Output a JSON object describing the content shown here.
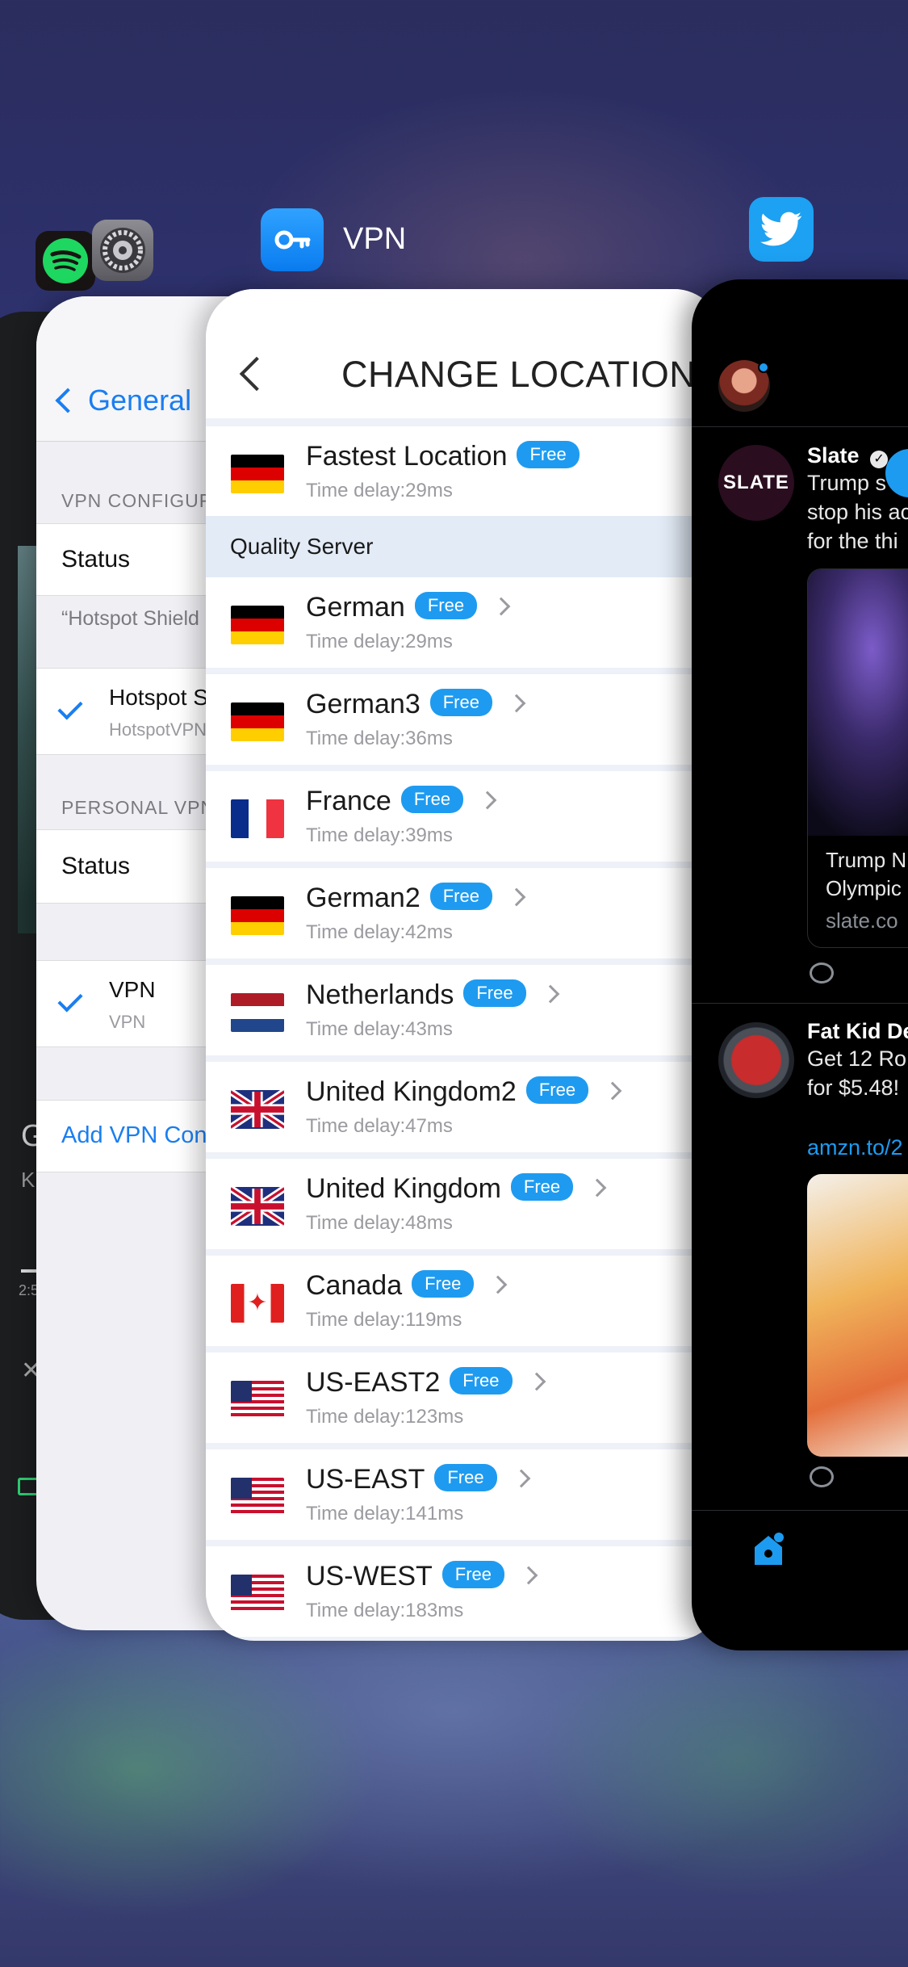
{
  "switcher": {
    "vpn_app_title": "VPN"
  },
  "music_card": {
    "letter_g": "G",
    "letter_k": "K",
    "time": "2:5"
  },
  "settings": {
    "back_label": "General",
    "vpn_config_header": "VPN CONFIGUR",
    "status_label_1": "Status",
    "note": "“Hotspot Shield",
    "vpn_profile_title": "Hotspot S",
    "vpn_profile_sub": "HotspotVPN",
    "personal_vpn_header": "PERSONAL VPN",
    "status_label_2": "Status",
    "personal_vpn_title": "VPN",
    "personal_vpn_sub": "VPN",
    "add_vpn_link": "Add VPN Con"
  },
  "vpn": {
    "title": "CHANGE LOCATION",
    "badge_label": "Free",
    "fastest": {
      "name": "Fastest Location",
      "delay": "Time delay:29ms",
      "flag": "de"
    },
    "section_header": "Quality Server",
    "locations": [
      {
        "name": "German",
        "delay": "Time delay:29ms",
        "flag": "de"
      },
      {
        "name": "German3",
        "delay": "Time delay:36ms",
        "flag": "de"
      },
      {
        "name": "France",
        "delay": "Time delay:39ms",
        "flag": "fr"
      },
      {
        "name": "German2",
        "delay": "Time delay:42ms",
        "flag": "de"
      },
      {
        "name": "Netherlands",
        "delay": "Time delay:43ms",
        "flag": "nl"
      },
      {
        "name": "United Kingdom2",
        "delay": "Time delay:47ms",
        "flag": "gb"
      },
      {
        "name": "United Kingdom",
        "delay": "Time delay:48ms",
        "flag": "gb"
      },
      {
        "name": "Canada",
        "delay": "Time delay:119ms",
        "flag": "ca"
      },
      {
        "name": "US-EAST2",
        "delay": "Time delay:123ms",
        "flag": "us"
      },
      {
        "name": "US-EAST",
        "delay": "Time delay:141ms",
        "flag": "us"
      },
      {
        "name": "US-WEST",
        "delay": "Time delay:183ms",
        "flag": "us"
      }
    ]
  },
  "twitter": {
    "tweet1": {
      "author": "Slate",
      "avatar_text": "SLATE",
      "line1": "Trump s",
      "line2": "stop his ac",
      "line3": "for the thi",
      "card_title_1": "Trump N",
      "card_title_2": "Olympic",
      "card_domain": "slate.co"
    },
    "tweet2": {
      "author": "Fat Kid De",
      "line1": "Get 12 Ro",
      "line2": "for $5.48!",
      "link": "amzn.to/2"
    }
  },
  "colors": {
    "accent_blue": "#1a7ef0",
    "badge_blue": "#1e9bf0",
    "twitter_blue": "#1da1f2"
  }
}
